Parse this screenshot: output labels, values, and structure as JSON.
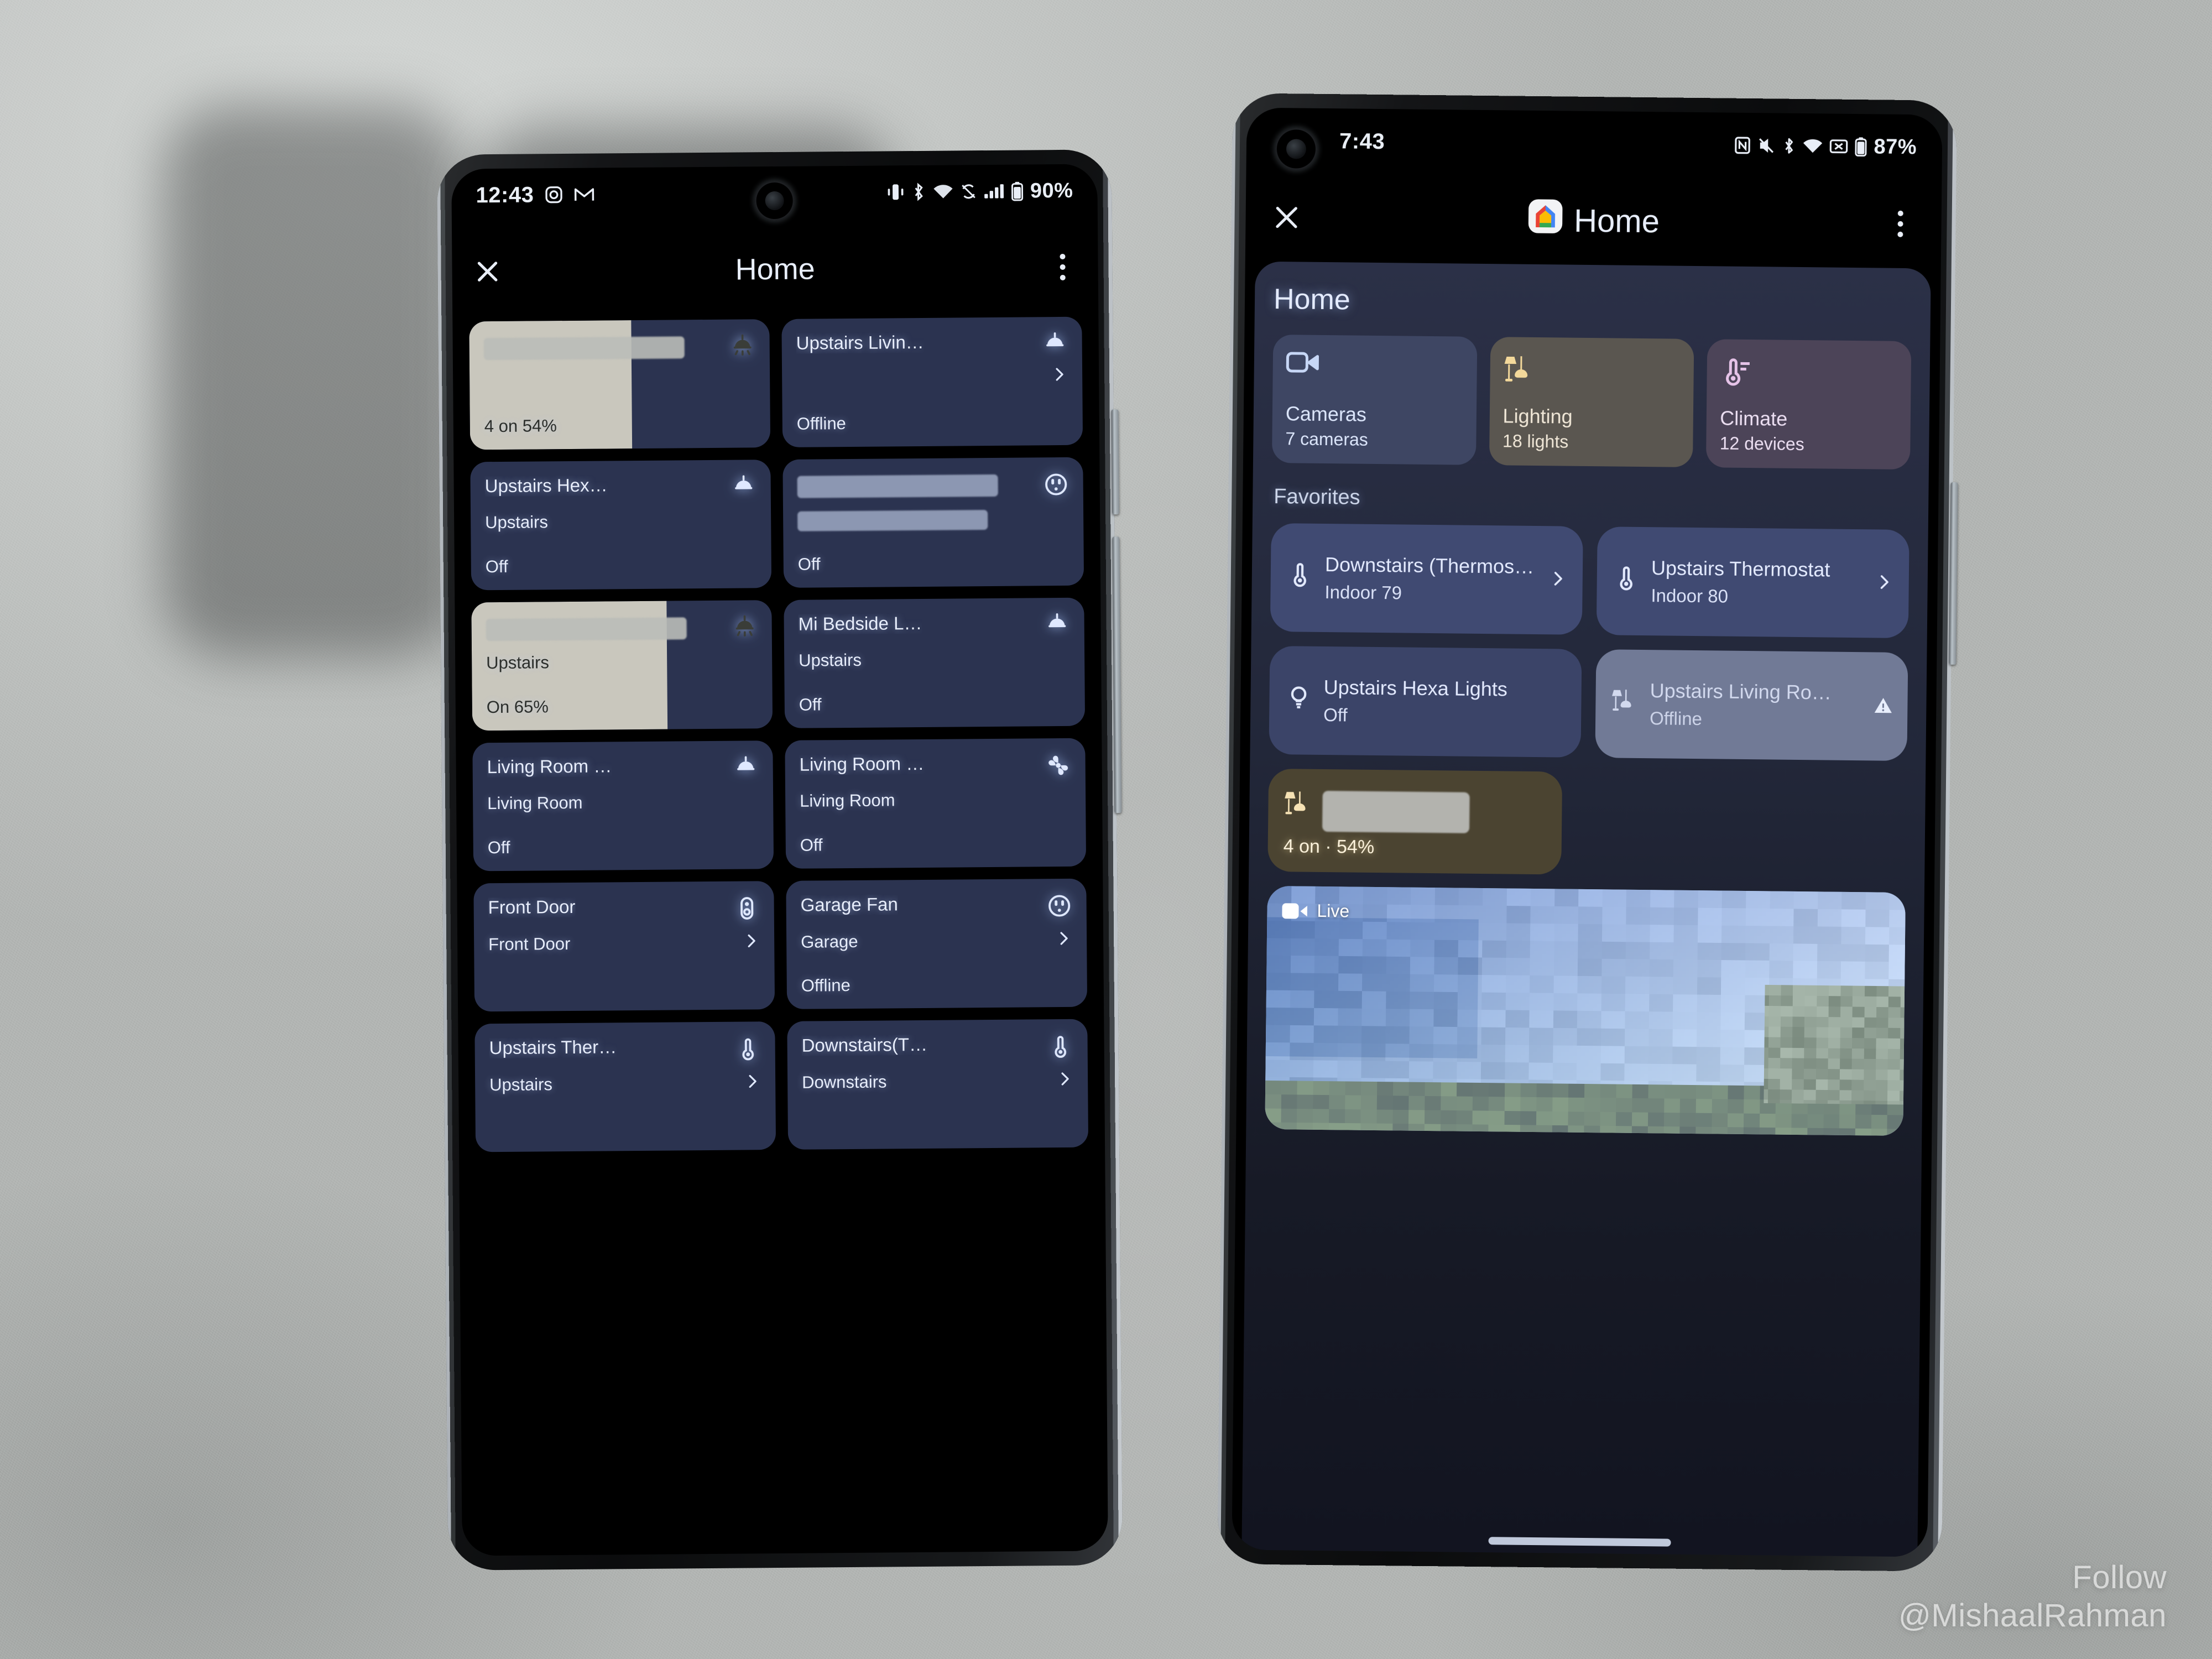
{
  "watermark": {
    "line1": "Follow",
    "line2": "@MishaalRahman"
  },
  "left_phone": {
    "status_bar": {
      "time": "12:43",
      "battery_percent": "90%",
      "icons": [
        "instagram-icon",
        "gmail-icon",
        "vibrate-icon",
        "bluetooth-audio-icon",
        "wifi-icon",
        "sync-disabled-icon",
        "signal-icon",
        "battery-icon"
      ]
    },
    "app_bar": {
      "title": "Home",
      "close_icon": "close-icon",
      "overflow_icon": "kebab-menu-icon"
    },
    "cards": [
      {
        "name": "",
        "name_redacted": true,
        "room": "",
        "state": "4 on 54%",
        "icon": "pendant-light-icon",
        "active": true,
        "fill_percent": 54,
        "trailing": ""
      },
      {
        "name": "Upstairs Livin…",
        "room": "",
        "state": "Offline",
        "icon": "pendant-light-icon",
        "active": false,
        "trailing": "chevron-right-icon"
      },
      {
        "name": "Upstairs Hex…",
        "room": "Upstairs",
        "state": "Off",
        "icon": "pendant-light-icon",
        "active": false,
        "trailing": ""
      },
      {
        "name": "",
        "name_redacted": true,
        "room": "",
        "room_redacted": true,
        "state": "Off",
        "icon": "outlet-icon",
        "active": false,
        "trailing": ""
      },
      {
        "name": "",
        "name_redacted": true,
        "room": "Upstairs",
        "state": "On 65%",
        "icon": "pendant-light-icon",
        "active": true,
        "fill_percent": 65,
        "trailing": ""
      },
      {
        "name": "Mi Bedside L…",
        "room": "Upstairs",
        "state": "Off",
        "icon": "pendant-light-icon",
        "active": false,
        "trailing": ""
      },
      {
        "name": "Living Room …",
        "room": "Living Room",
        "state": "Off",
        "icon": "pendant-light-icon",
        "active": false,
        "trailing": ""
      },
      {
        "name": "Living Room …",
        "room": "Living Room",
        "state": "Off",
        "icon": "fan-icon",
        "active": false,
        "trailing": ""
      },
      {
        "name": "Front Door",
        "room": "Front Door",
        "state": "",
        "icon": "doorbell-icon",
        "active": false,
        "trailing": "chevron-right-icon"
      },
      {
        "name": "Garage Fan",
        "room": "Garage",
        "state": "Offline",
        "icon": "outlet-icon",
        "active": false,
        "trailing": "chevron-right-icon"
      },
      {
        "name": "Upstairs Ther…",
        "room": "Upstairs",
        "state": "",
        "icon": "thermostat-icon",
        "active": false,
        "trailing": "chevron-right-icon"
      },
      {
        "name": "Downstairs(T…",
        "room": "Downstairs",
        "state": "",
        "icon": "thermostat-icon",
        "active": false,
        "trailing": "chevron-right-icon"
      }
    ]
  },
  "right_phone": {
    "status_bar": {
      "time": "7:43",
      "battery_percent": "87%",
      "icons": [
        "nfc-icon",
        "mute-icon",
        "bluetooth-icon",
        "wifi-icon",
        "signal-off-icon",
        "battery-icon"
      ]
    },
    "app_bar": {
      "title": "Home",
      "app_icon": "google-home-icon",
      "close_icon": "close-icon",
      "overflow_icon": "kebab-menu-icon"
    },
    "panel_title": "Home",
    "chips": [
      {
        "label": "Cameras",
        "sub": "7 cameras",
        "icon": "video-camera-icon",
        "bg": "#3e4663",
        "fg": "#dce6fb",
        "icon_color": "#c7d7f6"
      },
      {
        "label": "Lighting",
        "sub": "18 lights",
        "icon": "lamp-icon",
        "bg": "#5a5650",
        "fg": "#efe6d6",
        "icon_color": "#f3d89a"
      },
      {
        "label": "Climate",
        "sub": "12 devices",
        "icon": "thermostat-icon",
        "bg": "#4c4458",
        "fg": "#ecdff2",
        "icon_color": "#e6c3e8"
      }
    ],
    "favorites_title": "Favorites",
    "favorites": [
      {
        "name": "Downstairs (Thermos…",
        "state": "Indoor 79",
        "icon": "thermostat-icon",
        "trailing": "chevron-right-icon",
        "bg": "#404a72",
        "fg": "#e3eaff"
      },
      {
        "name": "Upstairs Thermostat",
        "state": "Indoor 80",
        "icon": "thermostat-icon",
        "trailing": "chevron-right-icon",
        "bg": "#404a72",
        "fg": "#e3eaff"
      },
      {
        "name": "Upstairs Hexa Lights",
        "state": "Off",
        "icon": "bulb-icon",
        "trailing": "",
        "bg": "#3b4468",
        "fg": "#e3eaff"
      },
      {
        "name": "Upstairs Living Ro…",
        "state": "Offline",
        "icon": "lamp-icon",
        "trailing": "warning-icon",
        "bg": "#717a96",
        "fg": "#d2d9ee"
      }
    ],
    "light_tile": {
      "name": "",
      "name_redacted": true,
      "state": "4 on · 54%",
      "icon": "lamp-icon",
      "fill_percent": 54
    },
    "camera": {
      "badge": "Live",
      "badge_icon": "video-camera-icon"
    }
  }
}
